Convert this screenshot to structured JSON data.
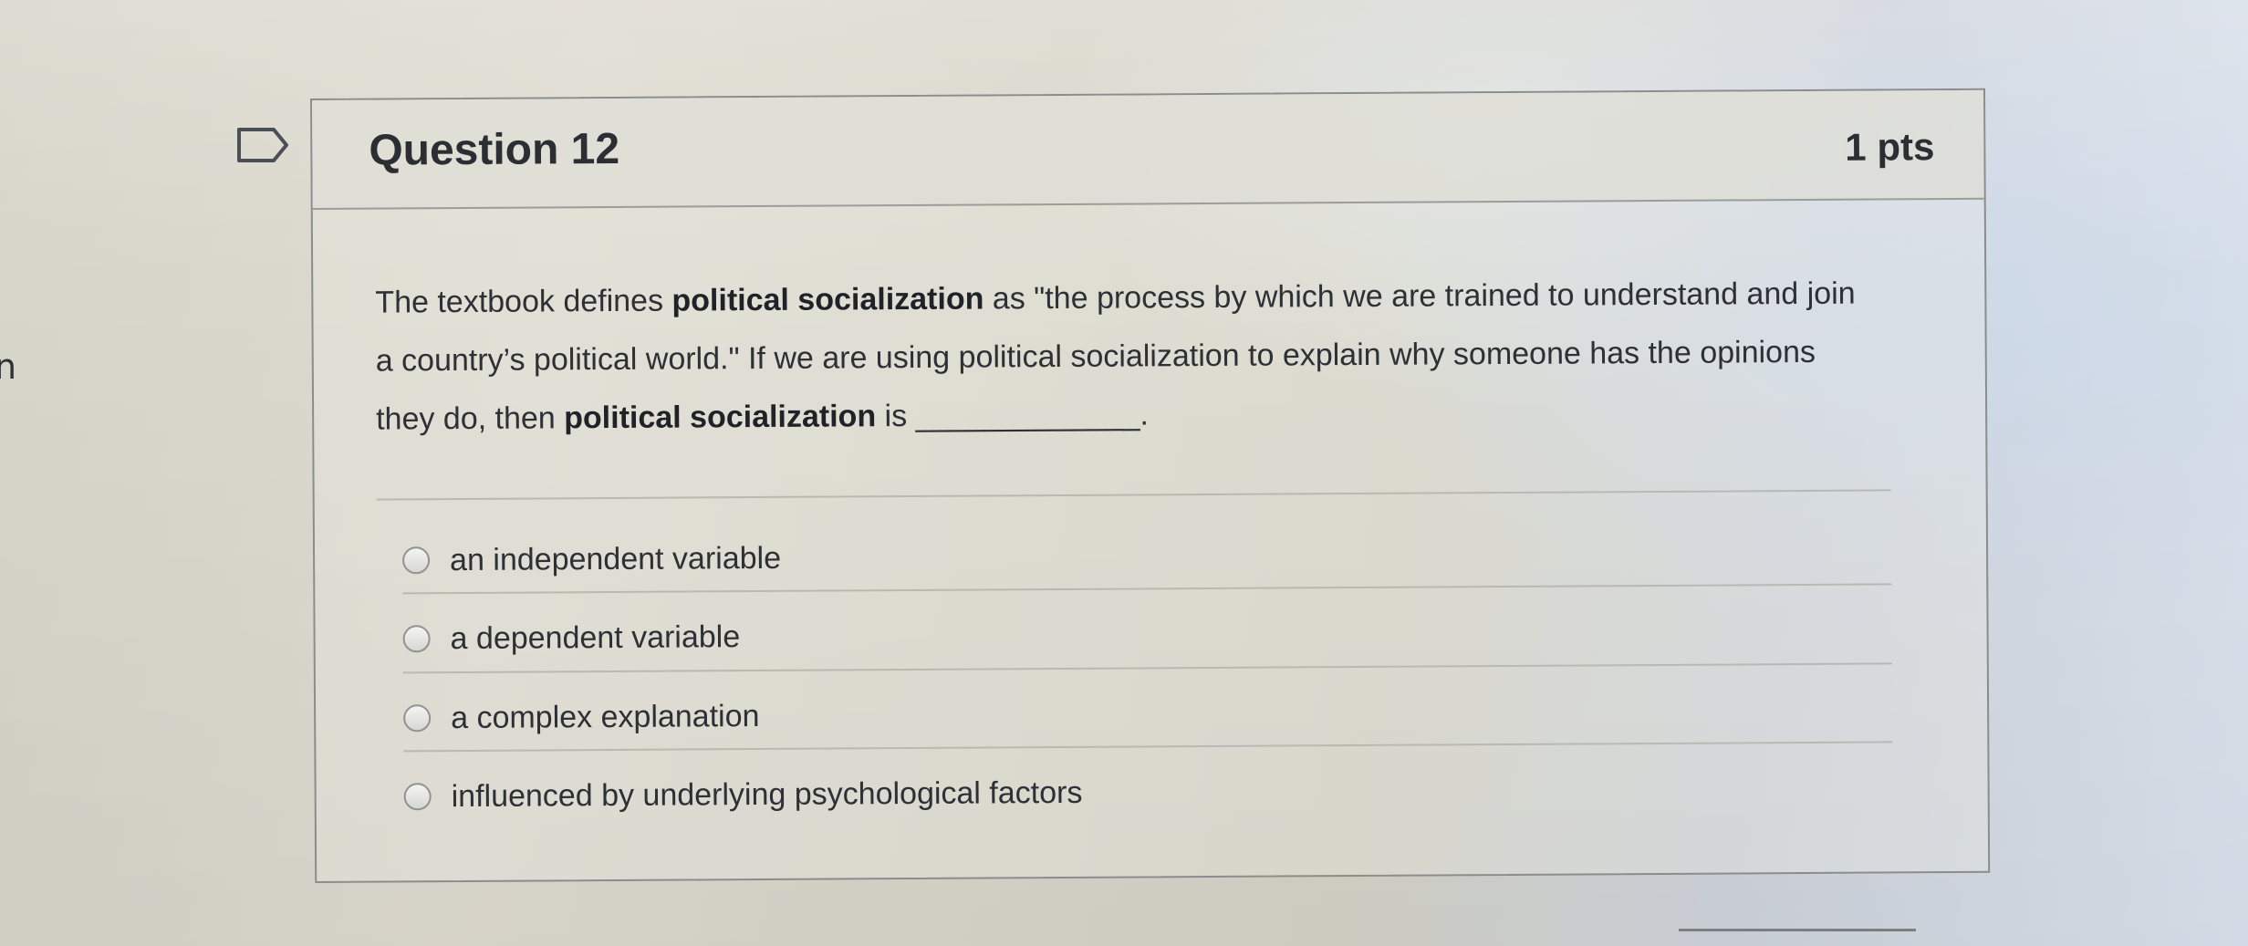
{
  "edge_text": "n",
  "question": {
    "title": "Question 12",
    "points": "1 pts",
    "text_part1": "The textbook defines ",
    "bold_term1": "political socialization",
    "text_part2": " as \"the process by which we are trained to understand and join a country’s political world.\" If we are using political socialization to explain why someone has the opinions they do, then ",
    "bold_term2": "political socialization",
    "text_part3": " is _____________."
  },
  "answers": [
    {
      "label": "an independent variable"
    },
    {
      "label": "a dependent variable"
    },
    {
      "label": "a complex explanation"
    },
    {
      "label": "influenced by underlying psychological factors"
    }
  ],
  "icons": {
    "flag": "flag-icon",
    "radio": "radio-button-icon"
  },
  "colors": {
    "text": "#2d3034",
    "border": "#8a8d8c"
  }
}
